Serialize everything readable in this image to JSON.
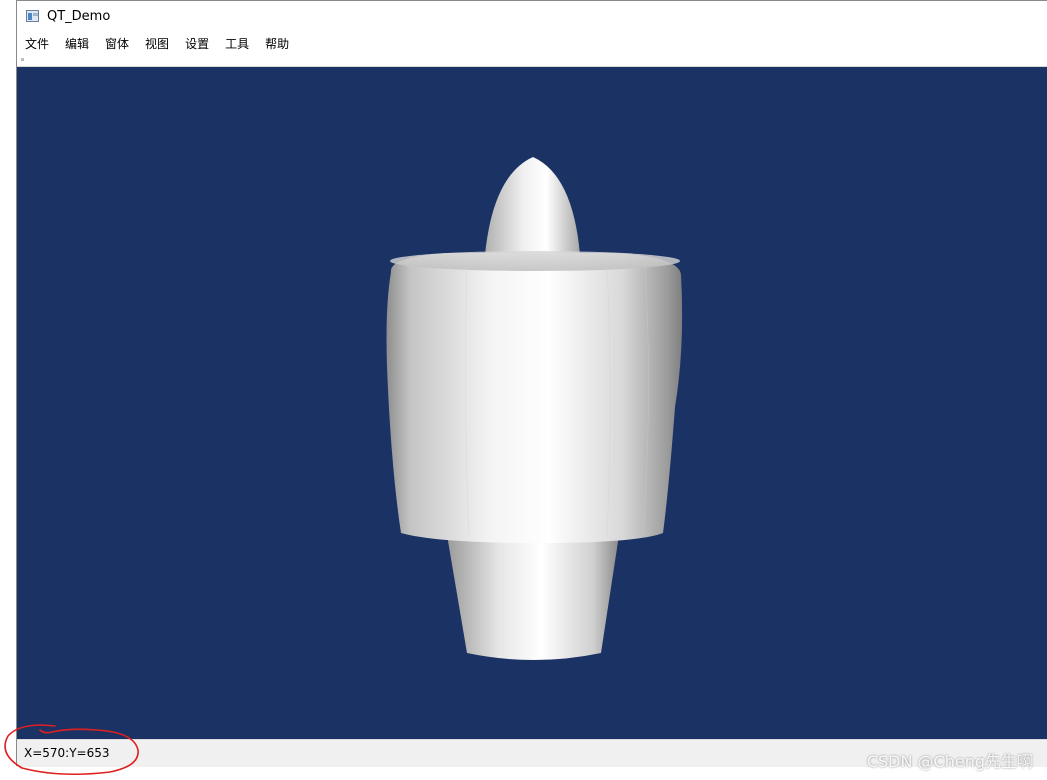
{
  "window": {
    "title": "QT_Demo",
    "app_icon": "qt-app-icon"
  },
  "menu": {
    "items": [
      {
        "label": "文件"
      },
      {
        "label": "编辑"
      },
      {
        "label": "窗体"
      },
      {
        "label": "视图"
      },
      {
        "label": "设置"
      },
      {
        "label": "工具"
      },
      {
        "label": "帮助"
      }
    ]
  },
  "viewport": {
    "background_color": "#1b3264",
    "model_color": "#f2f2f2",
    "model": "3d-engine-nacelle-model"
  },
  "status_bar": {
    "coords_text": "X=570:Y=653"
  },
  "annotation": {
    "color": "#e02020",
    "shape": "hand-drawn-circle"
  },
  "watermark": {
    "text": "CSDN @Cheng先生啊"
  }
}
